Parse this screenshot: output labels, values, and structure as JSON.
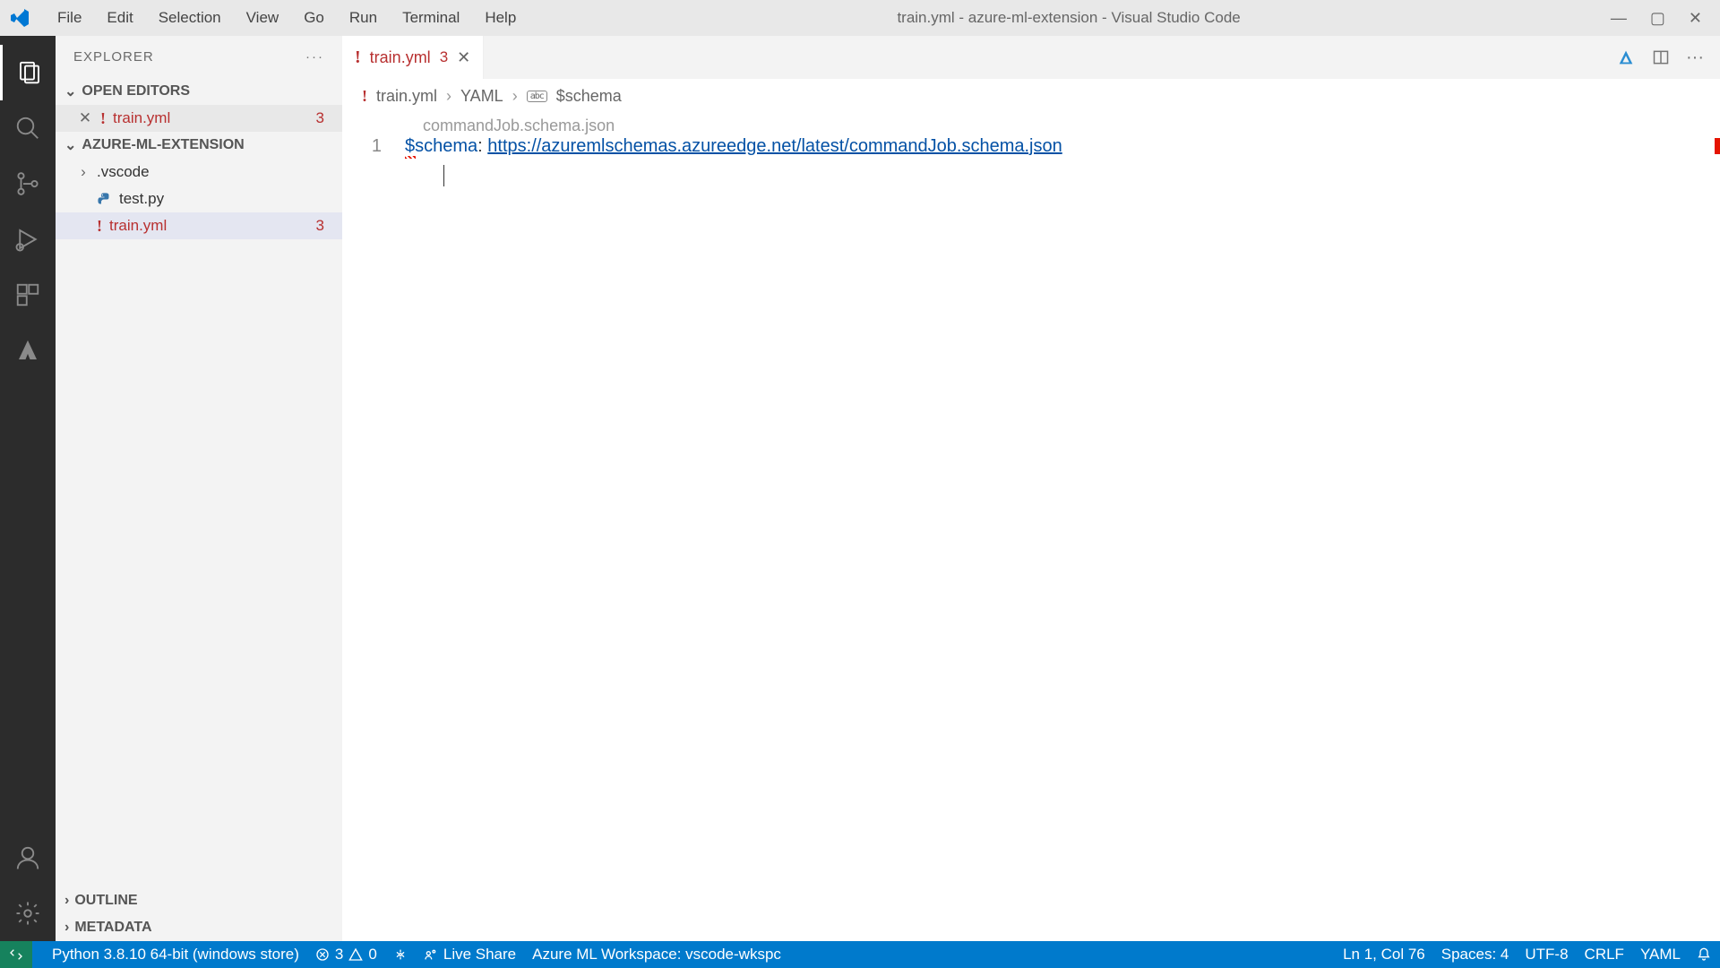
{
  "titlebar": {
    "menu": [
      "File",
      "Edit",
      "Selection",
      "View",
      "Go",
      "Run",
      "Terminal",
      "Help"
    ],
    "title": "train.yml - azure-ml-extension - Visual Studio Code"
  },
  "sidebar": {
    "header": "EXPLORER",
    "sections": {
      "open_editors": "OPEN EDITORS",
      "workspace": "AZURE-ML-EXTENSION",
      "outline": "OUTLINE",
      "metadata": "METADATA"
    },
    "open_editors_items": [
      {
        "name": "train.yml",
        "error_badge": "3",
        "is_error": true
      }
    ],
    "workspace_items": [
      {
        "name": ".vscode",
        "type": "folder"
      },
      {
        "name": "test.py",
        "type": "python"
      },
      {
        "name": "train.yml",
        "type": "yaml",
        "error_badge": "3",
        "is_error": true,
        "selected": true
      }
    ]
  },
  "editor": {
    "tab": {
      "name": "train.yml",
      "badge": "3"
    },
    "breadcrumb": {
      "file": "train.yml",
      "lang": "YAML",
      "symbol": "$schema"
    },
    "hint": "commandJob.schema.json",
    "line_number": "1",
    "code": {
      "key": "$schema",
      "colon": ":",
      "url": "https://azuremlschemas.azureedge.net/latest/commandJob.schema.json"
    }
  },
  "statusbar": {
    "python": "Python 3.8.10 64-bit (windows store)",
    "errors": "3",
    "warnings": "0",
    "liveshare": "Live Share",
    "workspace": "Azure ML Workspace: vscode-wkspc",
    "position": "Ln 1, Col 76",
    "spaces": "Spaces: 4",
    "encoding": "UTF-8",
    "eol": "CRLF",
    "lang": "YAML"
  }
}
